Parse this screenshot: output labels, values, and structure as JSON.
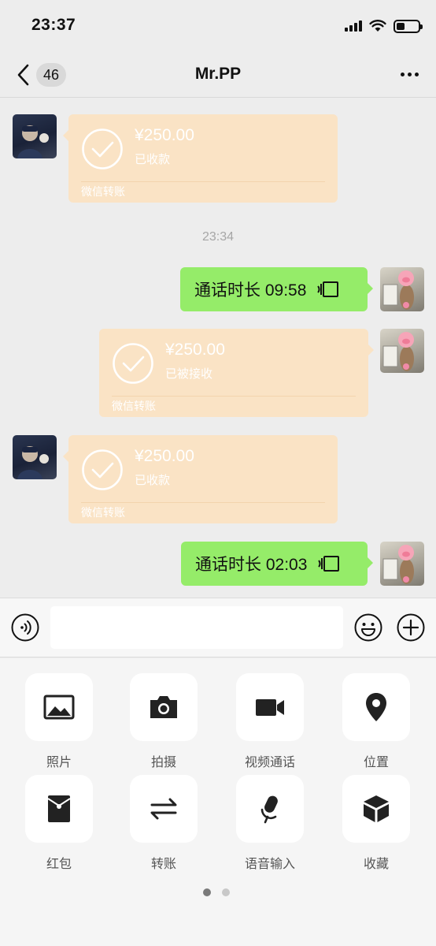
{
  "status_bar": {
    "time": "23:37"
  },
  "nav": {
    "unread_count": "46",
    "title": "Mr.PP"
  },
  "messages": [
    {
      "type": "transfer",
      "side": "left",
      "amount": "¥250.00",
      "status": "已收款",
      "label": "微信转账"
    },
    {
      "type": "timestamp",
      "text": "23:34"
    },
    {
      "type": "call",
      "side": "right",
      "text": "通话时长 09:58"
    },
    {
      "type": "transfer",
      "side": "right",
      "amount": "¥250.00",
      "status": "已被接收",
      "label": "微信转账"
    },
    {
      "type": "transfer",
      "side": "left",
      "amount": "¥250.00",
      "status": "已收款",
      "label": "微信转账"
    },
    {
      "type": "call",
      "side": "right",
      "text": "通话时长 02:03"
    }
  ],
  "input": {
    "value": "",
    "placeholder": ""
  },
  "tools": [
    {
      "label": "照片",
      "icon": "photo-icon"
    },
    {
      "label": "拍摄",
      "icon": "camera-icon"
    },
    {
      "label": "视频通话",
      "icon": "video-call-icon"
    },
    {
      "label": "位置",
      "icon": "location-icon"
    },
    {
      "label": "红包",
      "icon": "red-packet-icon"
    },
    {
      "label": "转账",
      "icon": "transfer-icon"
    },
    {
      "label": "语音输入",
      "icon": "microphone-icon"
    },
    {
      "label": "收藏",
      "icon": "favorites-icon"
    }
  ],
  "pager": {
    "pages": 2,
    "current": 1
  },
  "colors": {
    "background": "#ededed",
    "transfer_card": "#fae3c5",
    "call_bubble": "#95ec69",
    "panel": "#f5f5f5"
  }
}
